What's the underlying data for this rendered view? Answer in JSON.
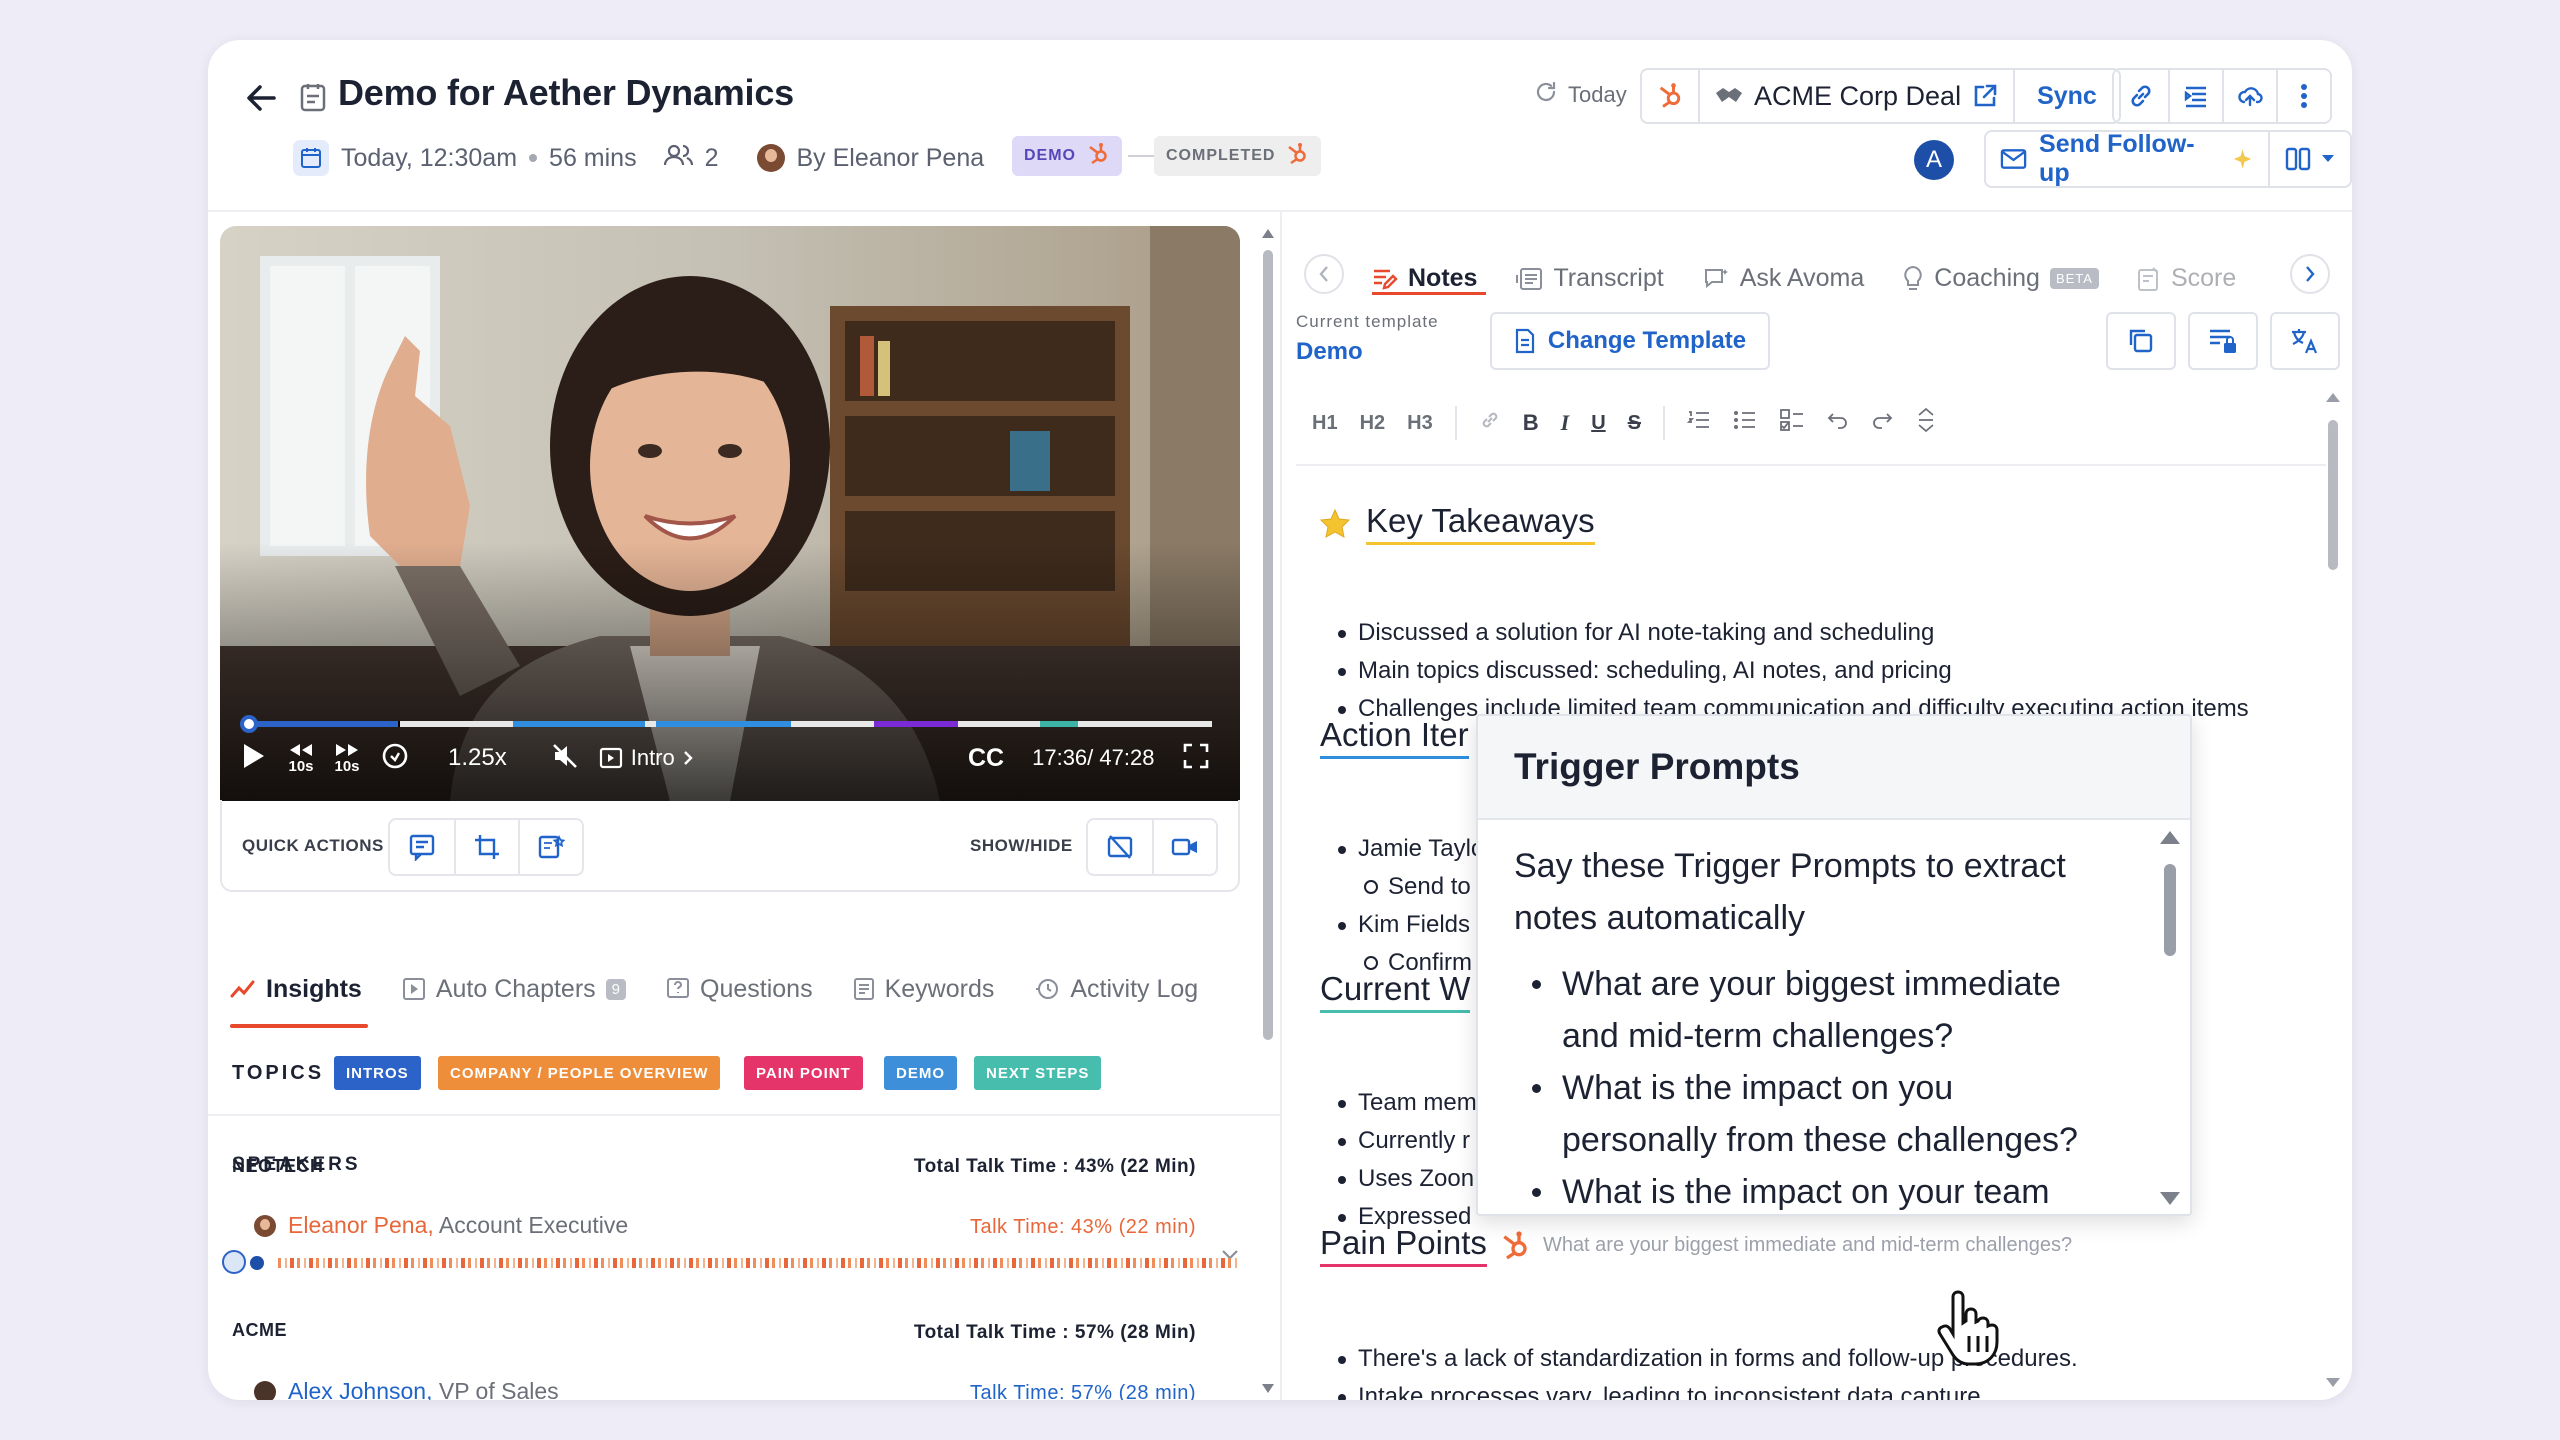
{
  "header": {
    "title": "Demo for Aether Dynamics",
    "date": "Today, 12:30am",
    "duration": "56 mins",
    "attendees": "2",
    "owner": "By Eleanor Pena",
    "tag_demo": "DEMO",
    "tag_completed": "COMPLETED",
    "today": "Today",
    "deal_name": "ACME Corp Deal",
    "sync": "Sync",
    "avatar_letter": "A",
    "follow_up": "Send Follow-up"
  },
  "video": {
    "speed": "1.25x",
    "chapter": "Intro",
    "time": "17:36/ 47:28",
    "cc": "CC",
    "skip_back": "10s",
    "skip_fwd": "10s",
    "progress_fraction": 0.03
  },
  "quick_actions": {
    "label": "QUICK ACTIONS",
    "show_hide": "SHOW/HIDE"
  },
  "left_tabs": {
    "insights": "Insights",
    "chapters": "Auto Chapters",
    "chapters_count": "9",
    "questions": "Questions",
    "keywords": "Keywords",
    "activity": "Activity Log"
  },
  "topics": {
    "label": "TOPICS",
    "items": [
      {
        "label": "INTROS",
        "color": "#2c63c9"
      },
      {
        "label": "COMPANY / PEOPLE OVERVIEW",
        "color": "#ef8e3a"
      },
      {
        "label": "PAIN POINT",
        "color": "#e4346a"
      },
      {
        "label": "DEMO",
        "color": "#3d8fd9"
      },
      {
        "label": "NEXT STEPS",
        "color": "#47bdae"
      }
    ]
  },
  "speakers": {
    "label": "SPEAKERS",
    "neotech": {
      "company": "NEOTECH",
      "total": "Total Talk Time : 43% (22 Min)",
      "name": "Eleanor Pena,",
      "role": "Account Executive",
      "talk": "Talk Time: 43%  (22 min)"
    },
    "acme": {
      "company": "ACME",
      "total": "Total Talk Time : 57% (28 Min)",
      "name": "Alex Johnson,",
      "role": "VP of Sales",
      "talk": "Talk Time: 57%  (28 min)"
    }
  },
  "right_tabs": {
    "notes": "Notes",
    "transcript": "Transcript",
    "ask": "Ask Avoma",
    "coaching": "Coaching",
    "beta": "BETA",
    "score": "Score"
  },
  "template": {
    "label": "Current template",
    "value": "Demo",
    "change": "Change Template"
  },
  "editor": {
    "h1": "H1",
    "h2": "H2",
    "h3": "H3"
  },
  "notes": {
    "key_takeaways": "Key Takeaways",
    "takeaways": [
      "Discussed a solution for AI note-taking and scheduling",
      "Main topics discussed: scheduling, AI notes, and pricing",
      "Challenges include limited team communication and difficulty executing action items"
    ],
    "action_items": "Action Iter",
    "action_lines": [
      "Jamie Taylc",
      "Send to",
      "Kim Fields",
      "Confirm"
    ],
    "current": "Current W",
    "current_lines": [
      "Team mem",
      "Currently r",
      "Uses Zoon",
      "Expressed"
    ],
    "pain_points": "Pain Points",
    "pain_hint": "What are your biggest immediate and mid-term challenges?",
    "pain_lines": [
      "There's a lack of standardization in forms and follow-up procedures.",
      "Intake processes vary, leading to inconsistent data capture."
    ]
  },
  "popup": {
    "title": "Trigger Prompts",
    "intro": "Say these Trigger Prompts to extract notes automatically",
    "items": [
      "What are your biggest immediate and mid-term challenges?",
      "What is the impact on you personally from these challenges?",
      "What is the impact on your team"
    ]
  }
}
